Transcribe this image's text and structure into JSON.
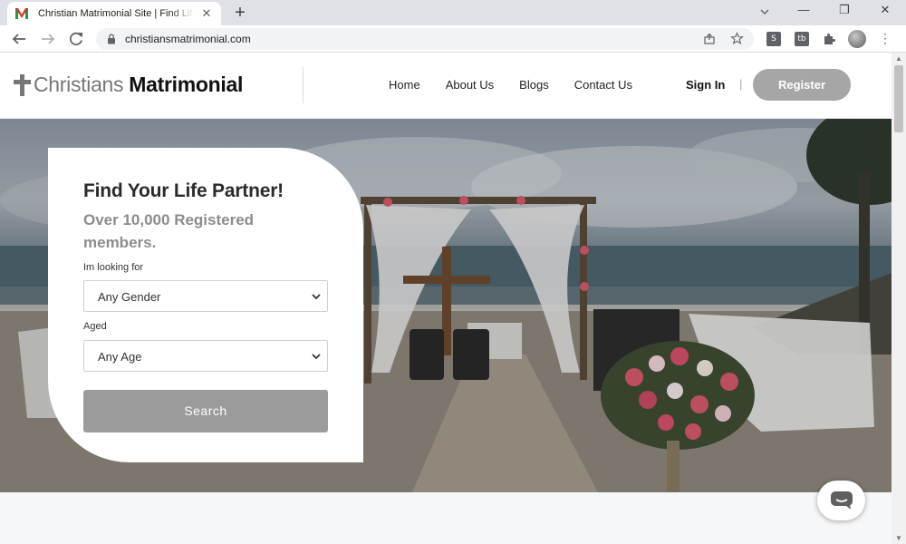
{
  "browser": {
    "tab_title": "Christian Matrimonial Site | Find Life Partner",
    "tab_close": "✕",
    "new_tab": "+",
    "url": "christiansmatrimonial.com",
    "window_minimize": "—",
    "window_restore": "❐",
    "window_close": "✕",
    "ext_one": "S",
    "ext_two": "tb",
    "menu": "⋮"
  },
  "header": {
    "logo_light": "Christians",
    "logo_bold": "Matrimonial",
    "nav": [
      "Home",
      "About Us",
      "Blogs",
      "Contact Us"
    ],
    "sign_in": "Sign In",
    "separator": "|",
    "register": "Register"
  },
  "search_card": {
    "title": "Find Your Life Partner!",
    "subtitle": "Over 10,000 Registered members.",
    "looking_for_label": "Im looking for",
    "gender_value": "Any Gender",
    "aged_label": "Aged",
    "age_value": "Any Age",
    "search_button": "Search"
  },
  "colors": {
    "register_button": "#a6a6a6",
    "search_button": "#9b9b9b",
    "subtitle": "#8c8c8c"
  },
  "icons": {
    "favicon": "matrimonial-m-icon",
    "chat": "chat-bubble-icon"
  }
}
